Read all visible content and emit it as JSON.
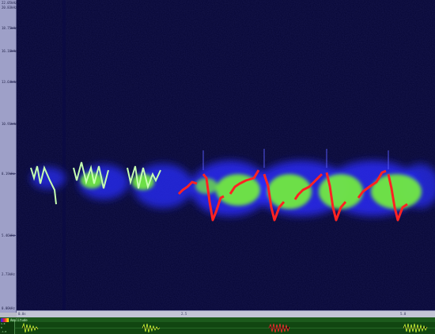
{
  "window": {
    "background": "#b9bbc9"
  },
  "frequency_axis": {
    "labels": [
      "22.05kHz",
      "20.83kHz",
      "18.75kHz",
      "16.16kHz",
      "13.64kHz",
      "10.91kHz",
      "8.19kHz",
      "5.46kHz",
      "2.73kHz",
      "0.00kHz"
    ]
  },
  "time_axis": {
    "labels": [
      "0.0s",
      "2.5",
      "5.0"
    ]
  },
  "waveform": {
    "label": "Amplitude",
    "axis_labels": [
      "1.0",
      "0",
      "-1.0"
    ]
  },
  "colors": {
    "spectrogram_bg": "#050533",
    "low_energy": "#2a2cff",
    "mid_energy": "#79ff2d",
    "high_energy": "#ff2222",
    "wave_bg": "#114611",
    "wave_signal": "#d5ff3a",
    "wave_highlight": "#ff3030"
  },
  "icons": [
    "color-scale-chip-icon"
  ]
}
